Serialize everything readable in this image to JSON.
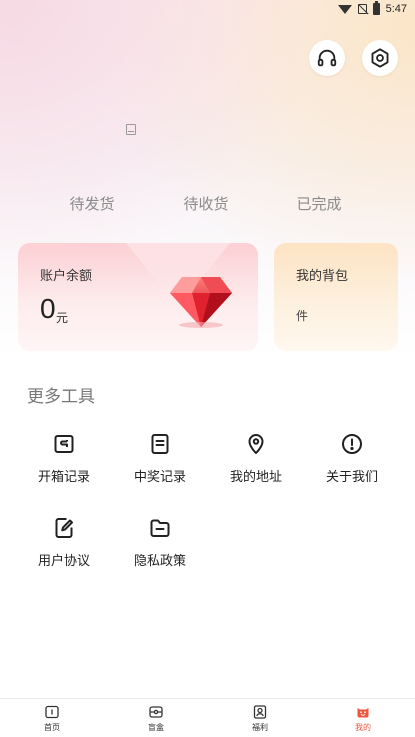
{
  "status_bar": {
    "time": "5:47"
  },
  "orders": {
    "tabs": [
      "待发货",
      "待收货",
      "已完成"
    ]
  },
  "balance_card": {
    "title": "账户余额",
    "value": "0",
    "unit": "元"
  },
  "bag_card": {
    "title": "我的背包",
    "subtitle": "件"
  },
  "tools": {
    "title": "更多工具",
    "items": [
      {
        "label": "开箱记录",
        "icon": "box-record-icon"
      },
      {
        "label": "中奖记录",
        "icon": "document-icon"
      },
      {
        "label": "我的地址",
        "icon": "location-pin-icon"
      },
      {
        "label": "关于我们",
        "icon": "info-alert-icon"
      },
      {
        "label": "用户协议",
        "icon": "edit-document-icon"
      },
      {
        "label": "隐私政策",
        "icon": "folder-icon"
      }
    ]
  },
  "tabbar": {
    "items": [
      {
        "label": "首页",
        "icon": "home-icon",
        "active": false
      },
      {
        "label": "盲盒",
        "icon": "blind-box-icon",
        "active": false
      },
      {
        "label": "福利",
        "icon": "welfare-icon",
        "active": false
      },
      {
        "label": "我的",
        "icon": "mine-face-icon",
        "active": true
      }
    ]
  },
  "colors": {
    "accent": "#f0553f",
    "balance_card": "#fccfd3",
    "bag_card": "#fde3c3"
  }
}
